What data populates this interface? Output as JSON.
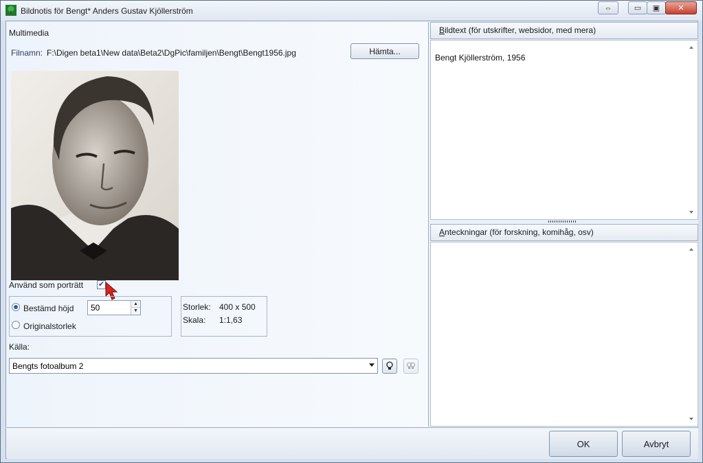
{
  "window": {
    "title": "Bildnotis för Bengt* Anders Gustav Kjöllerström"
  },
  "multimedia": {
    "section_label": "Multimedia",
    "filename_label": "Filnamn:",
    "filename_value": "F:\\Digen beta1\\New data\\Beta2\\DgPic\\familjen\\Bengt\\Bengt1956.jpg",
    "fetch_button": "Hämta...",
    "photo_icon": "portrait-photo",
    "use_as_portrait_label": "Använd som porträtt",
    "use_as_portrait_checked": true
  },
  "sizing": {
    "fixed_height_label": "Bestämd höjd",
    "fixed_height_value": "50",
    "original_size_label": "Originalstorlek",
    "selected": "fixed_height",
    "size_label": "Storlek:",
    "size_value": "400 x 500",
    "scale_label": "Skala:",
    "scale_value": "1:1,63"
  },
  "source": {
    "label": "Källa:",
    "value": "Bengts fotoalbum 2"
  },
  "caption_pane": {
    "header_first": "B",
    "header_rest": "ildtext (för utskrifter, websidor, med mera)",
    "text": "Bengt Kjöllerström, 1956"
  },
  "notes_pane": {
    "header_first": "A",
    "header_rest": "nteckningar (för forskning, komihåg, osv)",
    "text": ""
  },
  "footer": {
    "ok_label": "OK",
    "cancel_label": "Avbryt"
  },
  "colors": {
    "accent": "#2a5fa8",
    "close_red": "#c7422e"
  }
}
